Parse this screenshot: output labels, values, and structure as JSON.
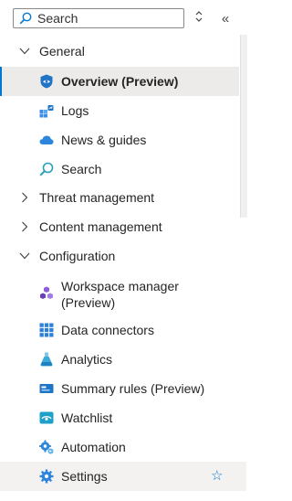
{
  "search": {
    "placeholder": "Search"
  },
  "toolbar": {
    "sort_icon": "chevron-up-down-icon",
    "collapse_glyph": "«"
  },
  "nav": {
    "general": {
      "label": "General",
      "expanded": true,
      "items": [
        {
          "label": "Overview (Preview)",
          "icon": "shield-icon",
          "selected": true
        },
        {
          "label": "Logs",
          "icon": "logs-icon"
        },
        {
          "label": "News & guides",
          "icon": "cloud-icon"
        },
        {
          "label": "Search",
          "icon": "search-icon"
        }
      ]
    },
    "threat_management": {
      "label": "Threat management",
      "expanded": false
    },
    "content_management": {
      "label": "Content management",
      "expanded": false
    },
    "configuration": {
      "label": "Configuration",
      "expanded": true,
      "items": [
        {
          "label_line1": "Workspace manager",
          "label_line2": "(Preview)",
          "icon": "cubes-icon"
        },
        {
          "label": "Data connectors",
          "icon": "grid-icon"
        },
        {
          "label": "Analytics",
          "icon": "flask-icon"
        },
        {
          "label": "Summary rules (Preview)",
          "icon": "summary-icon"
        },
        {
          "label": "Watchlist",
          "icon": "watchlist-icon"
        },
        {
          "label": "Automation",
          "icon": "automation-icon"
        },
        {
          "label": "Settings",
          "icon": "gear-icon",
          "hovered": true,
          "favorite_icon": "star-outline-icon"
        }
      ]
    }
  },
  "colors": {
    "accent": "#0078d4",
    "selected_bg": "#edebe9",
    "hover_bg": "#f3f2f1"
  }
}
